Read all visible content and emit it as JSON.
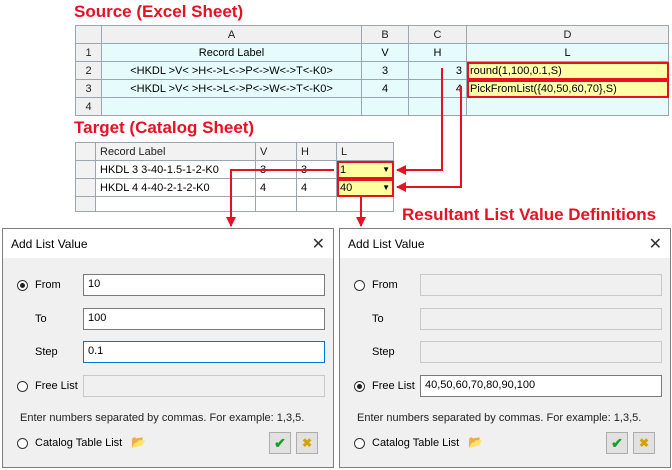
{
  "headings": {
    "source": "Source (Excel Sheet)",
    "target": "Target (Catalog Sheet)",
    "resultant": "Resultant List Value Definitions"
  },
  "source_sheet": {
    "columns": [
      "A",
      "B",
      "C",
      "D"
    ],
    "row_numbers": [
      "1",
      "2",
      "3",
      "4"
    ],
    "header_row": [
      "Record Label",
      "V",
      "H",
      "L"
    ],
    "rows": [
      [
        "<HKDL >V< >H<->L<->P<->W<->T<-K0>",
        "3",
        "3",
        "round(1,100,0.1,S)"
      ],
      [
        "<HKDL >V< >H<->L<->P<->W<->T<-K0>",
        "4",
        "4",
        "PickFromList({40,50,60,70},S)"
      ]
    ]
  },
  "catalog_sheet": {
    "headers": [
      "Record Label",
      "V",
      "H",
      "L"
    ],
    "rows": [
      [
        "HKDL 3 3-40-1.5-1-2-K0",
        "3",
        "3",
        "1"
      ],
      [
        "HKDL 4 4-40-2-1-2-K0",
        "4",
        "4",
        "40"
      ]
    ]
  },
  "dialogs": [
    {
      "title": "Add List Value",
      "from_label": "From",
      "from_value": "10",
      "to_label": "To",
      "to_value": "100",
      "step_label": "Step",
      "step_value": "0.1",
      "free_list_label": "Free List",
      "free_list_value": "",
      "hint": "Enter numbers separated by commas. For example: 1,3,5.",
      "catalog_table_label": "Catalog Table List",
      "selected": "from"
    },
    {
      "title": "Add List Value",
      "from_label": "From",
      "from_value": "",
      "to_label": "To",
      "to_value": "",
      "step_label": "Step",
      "step_value": "",
      "free_list_label": "Free List",
      "free_list_value": "40,50,60,70,80,90,100",
      "hint": "Enter numbers separated by commas. For example: 1,3,5.",
      "catalog_table_label": "Catalog Table List",
      "selected": "free_list"
    }
  ],
  "colors": {
    "accent": "#e81123",
    "source_cell": "#e6fbfb",
    "highlight": "#ffffa8",
    "ok": "#1a9e2a"
  },
  "icons": [
    "close-icon",
    "folder-icon",
    "checkmark-icon",
    "cancel-icon",
    "dropdown-arrow-icon"
  ]
}
